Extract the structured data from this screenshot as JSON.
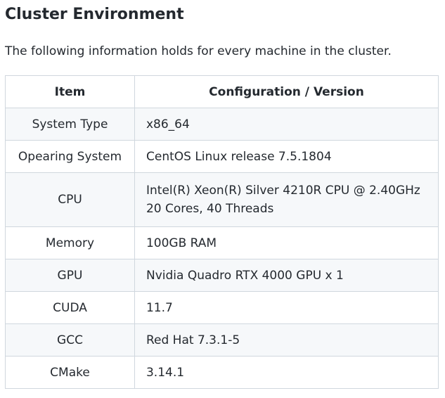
{
  "heading": "Cluster Environment",
  "intro": "The following information holds for every machine in the cluster.",
  "table": {
    "headers": [
      "Item",
      "Configuration / Version"
    ],
    "rows": [
      {
        "item": "System Type",
        "value": [
          "x86_64"
        ]
      },
      {
        "item": "Opearing System",
        "value": [
          "CentOS Linux release 7.5.1804"
        ]
      },
      {
        "item": "CPU",
        "value": [
          "Intel(R) Xeon(R) Silver 4210R CPU @ 2.40GHz",
          "20 Cores, 40 Threads"
        ]
      },
      {
        "item": "Memory",
        "value": [
          "100GB RAM"
        ]
      },
      {
        "item": "GPU",
        "value": [
          "Nvidia Quadro RTX 4000 GPU x 1"
        ]
      },
      {
        "item": "CUDA",
        "value": [
          "11.7"
        ]
      },
      {
        "item": "GCC",
        "value": [
          "Red Hat 7.3.1-5"
        ]
      },
      {
        "item": "CMake",
        "value": [
          "3.14.1"
        ]
      }
    ]
  }
}
